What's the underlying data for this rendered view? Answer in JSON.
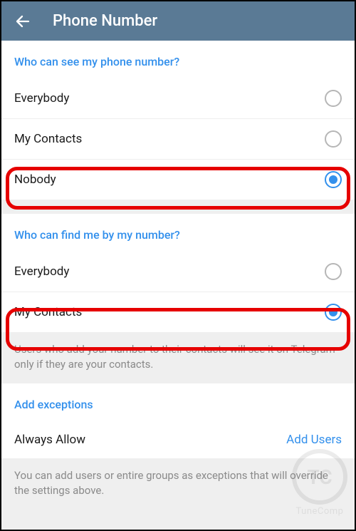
{
  "header": {
    "title": "Phone Number"
  },
  "section1": {
    "title": "Who can see my phone number?",
    "options": [
      {
        "label": "Everybody",
        "checked": false
      },
      {
        "label": "My Contacts",
        "checked": false
      },
      {
        "label": "Nobody",
        "checked": true
      }
    ]
  },
  "section2": {
    "title": "Who can find me by my number?",
    "options": [
      {
        "label": "Everybody",
        "checked": false
      },
      {
        "label": "My Contacts",
        "checked": true
      }
    ],
    "footer": "Users who add your number to their contacts will see it on Telegram only if they are your contacts."
  },
  "section3": {
    "title": "Add exceptions",
    "row": {
      "label": "Always Allow",
      "action": "Add Users"
    },
    "footer": "You can add users or entire groups as exceptions that will override the settings above."
  },
  "watermark": {
    "initials": "TC",
    "text": "TuneComp"
  }
}
